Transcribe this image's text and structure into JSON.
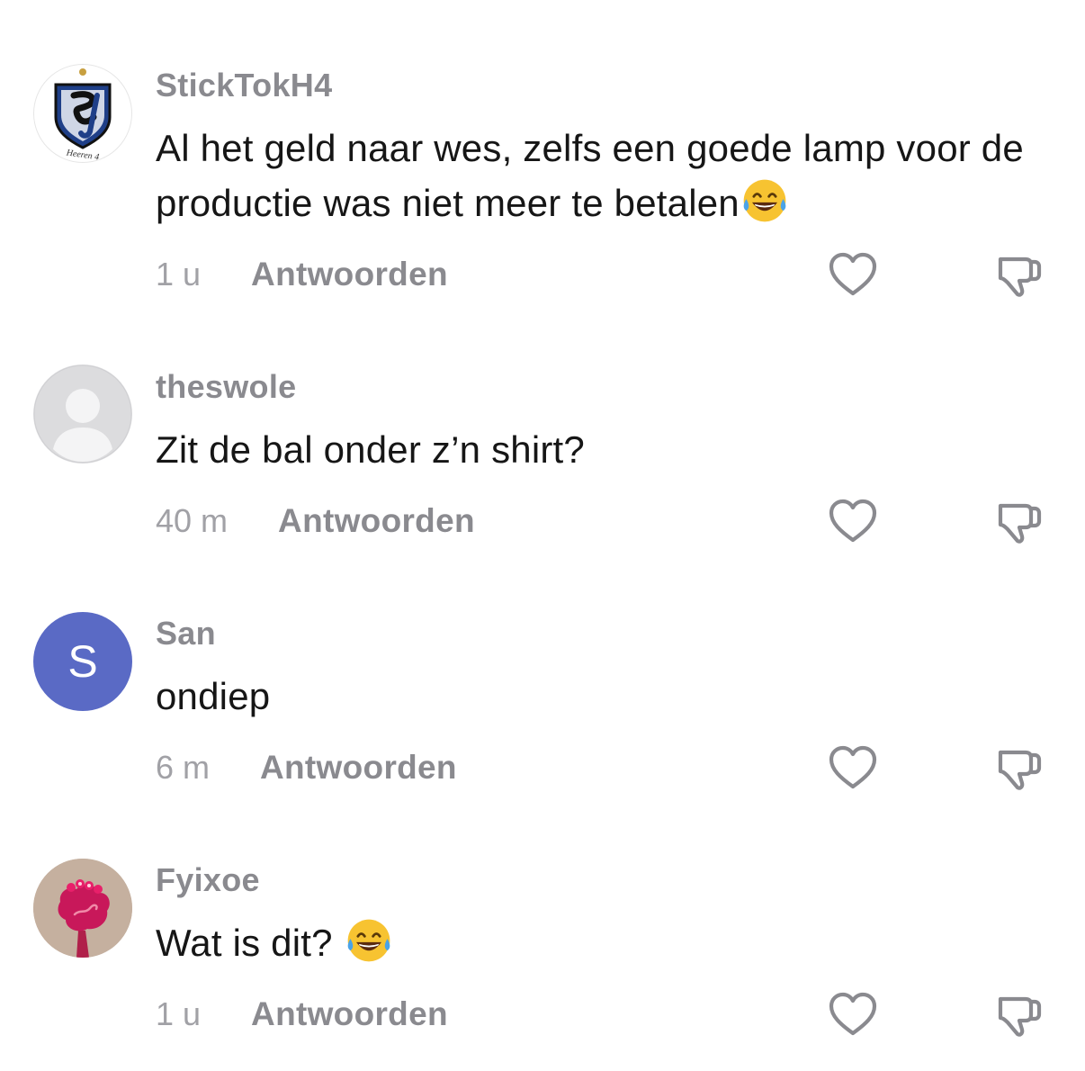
{
  "comments": [
    {
      "username": "StickTokH4",
      "text": "Al het geld naar wes, zelfs een goede lamp voor de productie was niet meer te betalen",
      "emoji": "tears-of-joy-emoji",
      "time": "1 u",
      "reply_label": "Antwoorden",
      "avatar": "heeren4-club-logo",
      "avatar_text": "Heeren 4"
    },
    {
      "username": "theswole",
      "text": "Zit de bal onder z’n shirt?",
      "time": "40 m",
      "reply_label": "Antwoorden",
      "avatar": "default-person-avatar"
    },
    {
      "username": "San",
      "text": "ondiep",
      "time": "6 m",
      "reply_label": "Antwoorden",
      "avatar": "letter-avatar",
      "avatar_letter": "S",
      "avatar_color": "#5a6ac5"
    },
    {
      "username": "Fyixoe",
      "text": "Wat is dit? ",
      "emoji": "tears-of-joy-emoji",
      "time": "1 u",
      "reply_label": "Antwoorden",
      "avatar": "red-flower-avatar"
    }
  ],
  "icons": {
    "like": "heart-outline-icon",
    "dislike": "thumbs-down-outline-icon"
  },
  "colors": {
    "username": "#8a8a8f",
    "text": "#161616",
    "time": "#a1a1a6",
    "icon": "#8a8a8f"
  }
}
